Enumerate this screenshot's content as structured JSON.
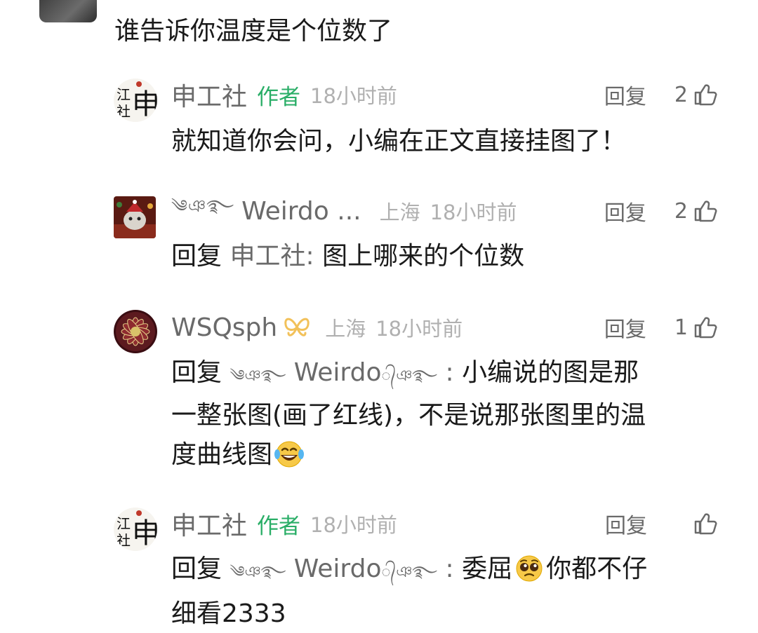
{
  "parent_comment": {
    "text": "谁告诉你温度是个位数了"
  },
  "colors": {
    "author_badge": "#2aae67",
    "name": "#6a6a6a",
    "meta": "#b0b0b0",
    "body": "#1a1a1a",
    "vip_icon": "#f2c15a"
  },
  "replies": [
    {
      "name": "申工社",
      "badge": "作者",
      "time": "18小时前",
      "reply_label": "回复",
      "likes": "2",
      "body": "就知道你会问，小编在正文直接挂图了！"
    },
    {
      "name_ornament": "༄ঞ࿐",
      "name": "Weirdo ...",
      "location": "上海",
      "time": "18小时前",
      "reply_label": "回复",
      "likes": "2",
      "body_prefix": "回复",
      "body_target": "申工社",
      "body_sep": ":",
      "body_text": "图上哪来的个位数"
    },
    {
      "name": "WSQsph",
      "vip_icon": "butterfly-icon",
      "location": "上海",
      "time": "18小时前",
      "reply_label": "回复",
      "likes": "1",
      "body_prefix": "回复",
      "body_target_ornament": "༄ঞ࿐",
      "body_target": "Weirdo",
      "body_target_suffix": "᭄ঞ࿐",
      "body_sep": ":",
      "body_text_1": "小编说的图是那",
      "body_text_2": "一整张图(画了红线)，不是说那张图里的温",
      "body_text_3": "度曲线图",
      "emoji": "laughing-tears-emoji"
    },
    {
      "name": "申工社",
      "badge": "作者",
      "time": "18小时前",
      "reply_label": "回复",
      "likes": "",
      "body_prefix": "回复",
      "body_target_ornament": "༄ঞ࿐",
      "body_target": "Weirdo",
      "body_target_suffix": "᭄ঞ࿐",
      "body_sep": ":",
      "body_text_1": "委屈",
      "emoji": "pleading-face-emoji",
      "body_text_2": "你都不仔",
      "body_text_3": "细看2333"
    }
  ]
}
